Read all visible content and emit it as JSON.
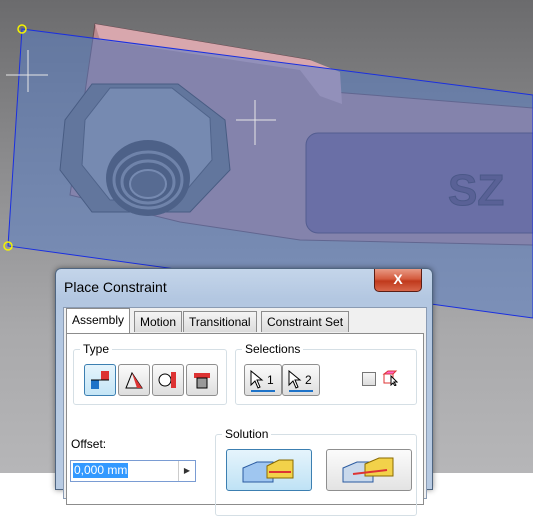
{
  "dialog": {
    "title": "Place Constraint",
    "close_glyph": "X",
    "tabs": [
      {
        "label": "Assembly",
        "active": true
      },
      {
        "label": "Motion",
        "active": false
      },
      {
        "label": "Transitional",
        "active": false
      },
      {
        "label": "Constraint Set",
        "active": false
      }
    ],
    "type_group": {
      "label": "Type",
      "buttons": [
        {
          "name": "mate-constraint-icon",
          "selected": true
        },
        {
          "name": "angle-constraint-icon",
          "selected": false
        },
        {
          "name": "tangent-constraint-icon",
          "selected": false
        },
        {
          "name": "insert-constraint-icon",
          "selected": false
        }
      ]
    },
    "selections_group": {
      "label": "Selections",
      "first_number": "1",
      "second_number": "2"
    },
    "offset": {
      "label": "Offset:",
      "value": "0,000 mm"
    },
    "solution_group": {
      "label": "Solution"
    }
  },
  "viewport": {
    "part_text": "SZ",
    "colors": {
      "background": "#8c8c8e",
      "plane": "#5a7ec4",
      "plane_edge": "#1a2fe0",
      "part": "#c48a92",
      "accent": "#3399ff"
    }
  }
}
